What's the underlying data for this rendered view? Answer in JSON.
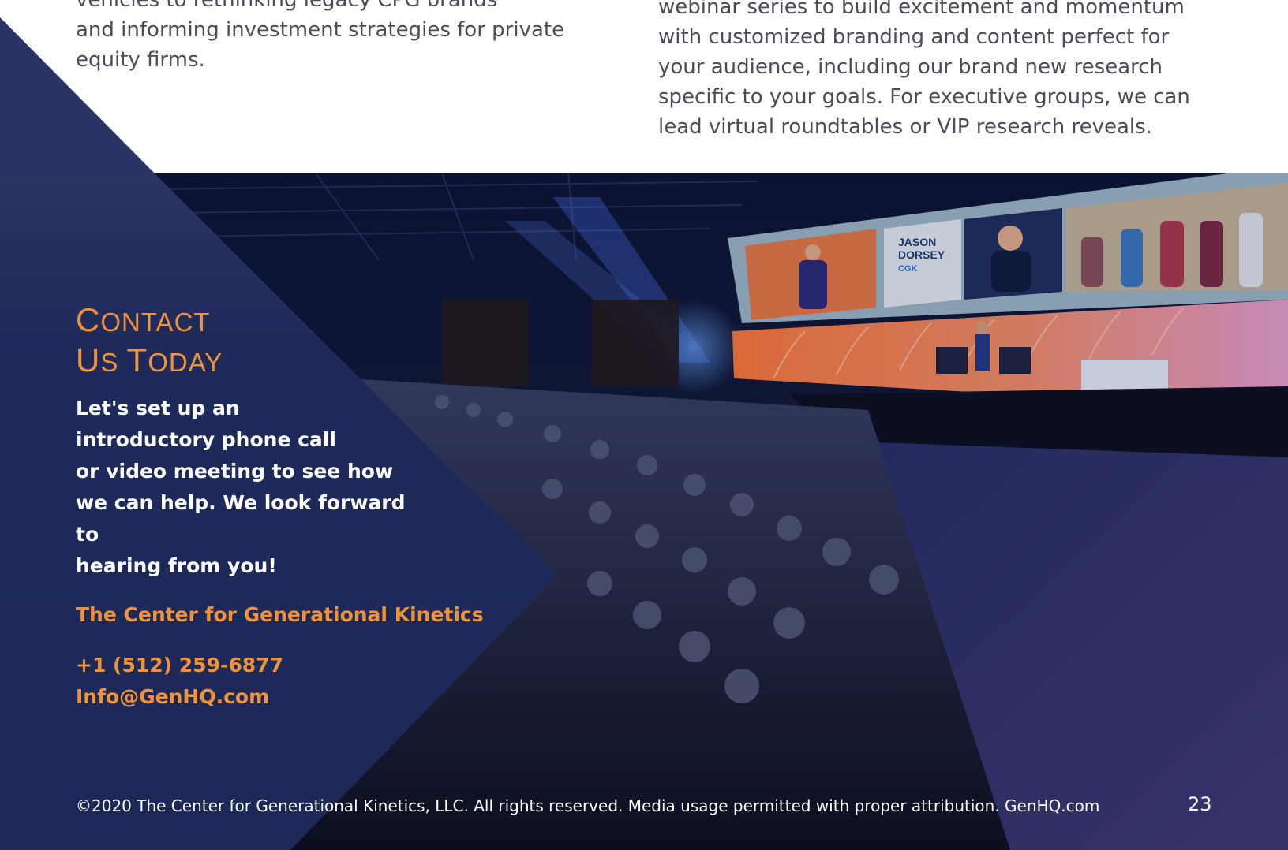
{
  "top": {
    "left_column": [
      "vehicles to rethinking legacy CPG brands",
      "and informing investment strategies for private",
      "equity firms."
    ],
    "right_column": [
      "webinar series to build excitement and momentum",
      "with customized branding and content perfect for",
      "your audience, including our brand new research",
      "specific to your goals. For executive groups, we can",
      "lead virtual roundtables or VIP research reveals."
    ]
  },
  "contact": {
    "heading_line1_cap": "C",
    "heading_line1_rest": "ONTACT",
    "heading_line2_cap1": "U",
    "heading_line2_rest1": "S ",
    "heading_line2_cap2": "T",
    "heading_line2_rest2": "ODAY",
    "body_lines": [
      "Let's set up an",
      "introductory phone call",
      "or video meeting to see how",
      "we can help. We look forward to",
      "hearing from you!"
    ],
    "organization": "The Center for Generational Kinetics",
    "phone": "+1 (512) 259-6877",
    "email": "Info@GenHQ.com"
  },
  "screen": {
    "name_line1": "JASON",
    "name_line2": "DORSEY",
    "logo": "CGK"
  },
  "footer": {
    "copyright": "©2020 The Center for Generational Kinetics, LLC. All rights reserved. Media usage permitted with proper attribution. GenHQ.com",
    "page_number": "23"
  },
  "colors": {
    "navy": "#1b2858",
    "accent_orange": "#f0923b",
    "body_gray": "#4a4d57"
  }
}
